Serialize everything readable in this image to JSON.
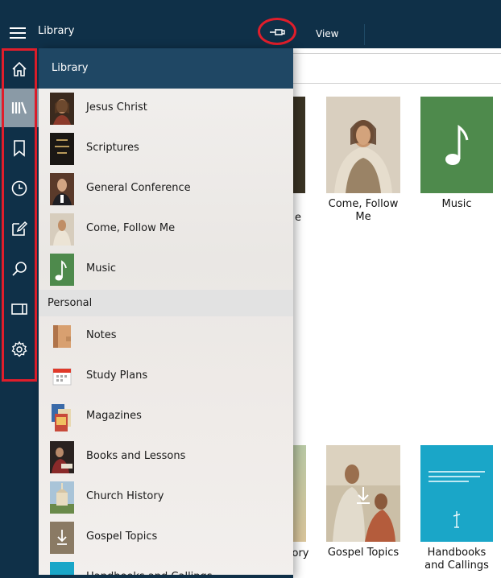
{
  "header": {
    "title": "Library",
    "view_tab": "View"
  },
  "rail": {
    "items": [
      {
        "icon": "home-icon"
      },
      {
        "icon": "library-icon"
      },
      {
        "icon": "bookmark-icon"
      },
      {
        "icon": "history-icon"
      },
      {
        "icon": "notes-icon"
      },
      {
        "icon": "search-icon"
      },
      {
        "icon": "screens-icon"
      },
      {
        "icon": "settings-icon"
      }
    ]
  },
  "flyout": {
    "title": "Library",
    "library_items": [
      {
        "label": "Jesus Christ"
      },
      {
        "label": "Scriptures"
      },
      {
        "label": "General Conference"
      },
      {
        "label": "Come, Follow Me"
      },
      {
        "label": "Music"
      }
    ],
    "section_label": "Personal",
    "personal_items": [
      {
        "label": "Notes"
      },
      {
        "label": "Study Plans"
      },
      {
        "label": "Magazines"
      },
      {
        "label": "Books and Lessons"
      },
      {
        "label": "Church History"
      },
      {
        "label": "Gospel Topics"
      },
      {
        "label": "Handbooks and Callings"
      }
    ]
  },
  "content": {
    "tiles_top": [
      {
        "label": "Come, Follow Me"
      },
      {
        "label": "Music"
      }
    ],
    "tiles_bottom": [
      {
        "label": "Gospel Topics"
      },
      {
        "label": "Handbooks and Callings"
      }
    ],
    "partial_label_top": "e",
    "partial_label_bottom": "ory"
  },
  "colors": {
    "nav_bg": "#0f3048",
    "flyout_header": "#1f4764",
    "highlight": "#e01e2b",
    "music_green": "#4e8a4c",
    "handbook_teal": "#1aa6c8"
  }
}
